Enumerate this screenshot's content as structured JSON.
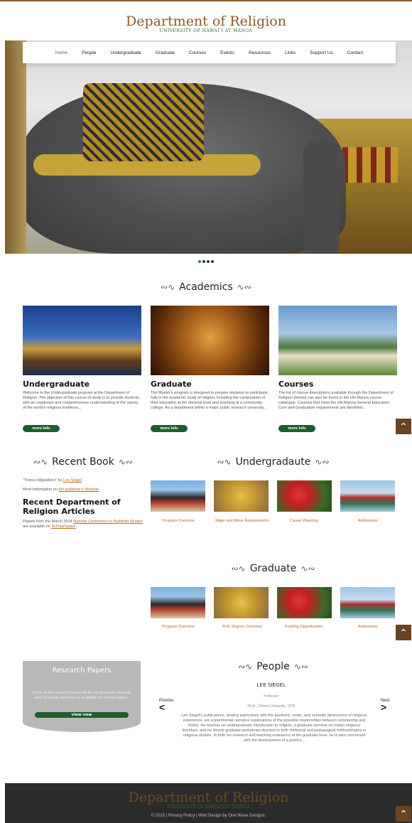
{
  "site": {
    "title": "Department of Religion",
    "subtitle": "UNIVERSITY OF HAWAI'I AT MANOA"
  },
  "nav": [
    "Home",
    "People",
    "Undergraduate",
    "Graduate",
    "Courses",
    "Events",
    "Resources",
    "Links",
    "Support Us",
    "Contact"
  ],
  "academics": {
    "title": "Academics",
    "items": [
      {
        "title": "Undergraduate",
        "text": "Welcome to the Undergraduate program at the Department of Religion. The objective of this course of study is to provide students with an expansive and comprehensive understanding of the variety of the world's religious traditions...",
        "button": "more info"
      },
      {
        "title": "Graduate",
        "text": "The Master's program is designed to prepare students to participate fully in the academic study of religion, including the continuation of their education at the doctoral level and teaching at a community college. As a department within a major public research university...",
        "button": "more info"
      },
      {
        "title": "Courses",
        "text": "The list of course descriptions available through the Department of Religion (below) can also be found in the UH Manoa course catalogue. Courses that meet the UH Manoa General Education Core and Graduation requirements are identified...",
        "button": "more info"
      }
    ]
  },
  "recent_book": {
    "title": "Recent Book",
    "line1_prefix": "\"Trance-Migrations\" by ",
    "line1_link": "Lee Siegel",
    "line1_suffix": ".",
    "line2_prefix": "More information on ",
    "line2_link": "the publisher's Website",
    "line2_suffix": "."
  },
  "recent_articles": {
    "title": "Recent Department of Religion Articles",
    "prefix": "Papers from the March 2014 ",
    "link1": "Numata Conference in Buddhist Studies",
    "middle": " are available on ",
    "link2": "ScholarSpace",
    "suffix": "."
  },
  "undergraduate": {
    "title": "Undergradaute",
    "items": [
      "Program Overview",
      "Major and Minor Requirements",
      "Career Planning",
      "Admissions"
    ]
  },
  "graduate": {
    "title": "Graduate",
    "items": [
      "Program Overview",
      "M.A. Degree Overview",
      "Funding Opportunities",
      "Admissions"
    ]
  },
  "research": {
    "title": "Research Papers",
    "text": "Some of the research produced by our graduate students and by faculty members is available on ScholarSpace.",
    "button": "view now"
  },
  "people": {
    "title": "People",
    "name": "LEE SIEGEL",
    "role": "Professor",
    "degree": "Ph.D., Oxford University, 1975",
    "prev": "Previou",
    "next": "Next",
    "bio": "Lee Siegel's publications, dealing particularly with the aesthetic, erotic, and comedic dimensions of religious experience, are experimental narrative explorations of the possible relationships between scholarship and fiction. He teaches an undergraduate introduction to religion, a graduate seminar on Indian religious literature, and he directs graduate workshops devoted to both rhetorical and pedagogical methodologies in religious studies. In both his research and teaching endeavors at the graduate level, he is also concerned with the development of a poetics..."
  },
  "footer": {
    "title": "Department of Religion",
    "subtitle": "UNIVERSITY OF HAWAI'I AT MANOA",
    "copyright": "© 2015 | Privacy Policy | Web Design by One Wave Designs."
  },
  "colors": {
    "brand_brown": "#8a5a2b",
    "brand_green": "#1e5e2e",
    "link_orange": "#b5651d"
  }
}
